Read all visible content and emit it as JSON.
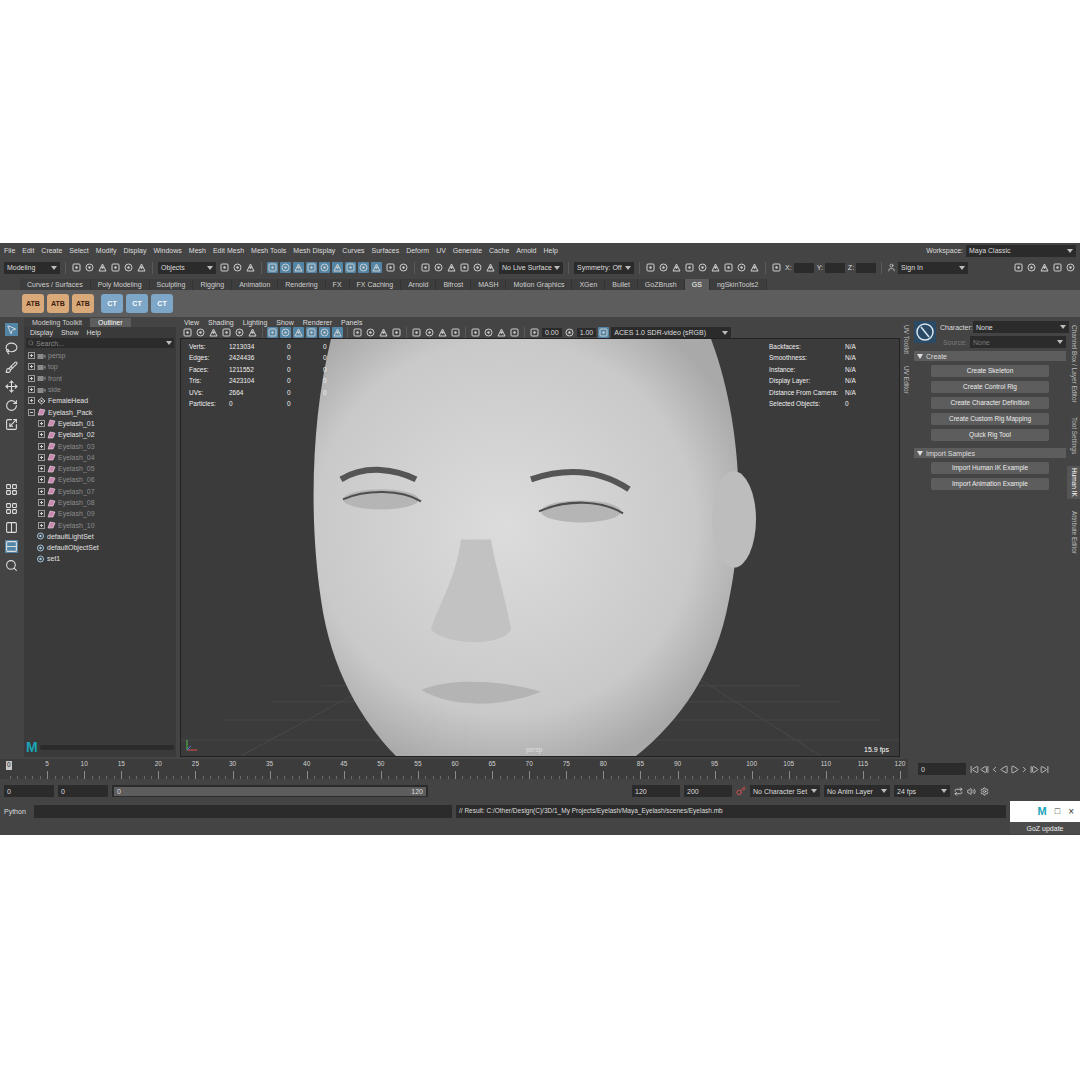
{
  "menu_bar": {
    "items": [
      "File",
      "Edit",
      "Create",
      "Select",
      "Modify",
      "Display",
      "Windows",
      "Mesh",
      "Edit Mesh",
      "Mesh Tools",
      "Mesh Display",
      "Curves",
      "Surfaces",
      "Deform",
      "UV",
      "Generate",
      "Cache",
      "Arnold",
      "Help"
    ],
    "workspace_label": "Workspace:",
    "workspace": "Maya Classic"
  },
  "status_line": {
    "menu_set": "Modeling",
    "select_mode": "Objects",
    "live_surface": "No Live Surface",
    "symmetry": "Symmetry: Off",
    "coords": [
      "X:",
      "Y:",
      "Z:"
    ],
    "sign_in": "Sign In"
  },
  "shelf": {
    "tabs": [
      {
        "label": "Curves / Surfaces",
        "selected": false
      },
      {
        "label": "Poly Modeling",
        "selected": false
      },
      {
        "label": "Sculpting",
        "selected": false
      },
      {
        "label": "Rigging",
        "selected": false
      },
      {
        "label": "Animation",
        "selected": false
      },
      {
        "label": "Rendering",
        "selected": false
      },
      {
        "label": "FX",
        "selected": false
      },
      {
        "label": "FX Caching",
        "selected": false
      },
      {
        "label": "Arnold",
        "selected": false
      },
      {
        "label": "Bifrost",
        "selected": false
      },
      {
        "label": "MASH",
        "selected": false
      },
      {
        "label": "Motion Graphics",
        "selected": false
      },
      {
        "label": "XGen",
        "selected": false
      },
      {
        "label": "Bullet",
        "selected": false
      },
      {
        "label": "GoZBrush",
        "selected": false
      },
      {
        "label": "GS",
        "selected": true
      },
      {
        "label": "ngSkinTools2",
        "selected": false
      }
    ],
    "buttons": [
      "ATB",
      "ATB",
      "ATB",
      "CT",
      "CT",
      "CT"
    ]
  },
  "outliner": {
    "tabs": [
      {
        "label": "Modeling Toolkit",
        "selected": false
      },
      {
        "label": "Outliner",
        "selected": true
      }
    ],
    "menu": [
      "Display",
      "Show",
      "Help"
    ],
    "search_placeholder": "Search...",
    "items": [
      {
        "name": "persp",
        "kind": "camera",
        "depth": 0,
        "dimmed": true,
        "expandable": true,
        "expanded": false
      },
      {
        "name": "top",
        "kind": "camera",
        "depth": 0,
        "dimmed": true,
        "expandable": true,
        "expanded": false
      },
      {
        "name": "front",
        "kind": "camera",
        "depth": 0,
        "dimmed": true,
        "expandable": true,
        "expanded": false
      },
      {
        "name": "side",
        "kind": "camera",
        "depth": 0,
        "dimmed": true,
        "expandable": true,
        "expanded": false
      },
      {
        "name": "FemaleHead",
        "kind": "group",
        "depth": 0,
        "dimmed": false,
        "expandable": true,
        "expanded": false
      },
      {
        "name": "Eyelash_Pack",
        "kind": "mesh",
        "depth": 0,
        "dimmed": false,
        "expandable": true,
        "expanded": true
      },
      {
        "name": "Eyelash_01",
        "kind": "mesh",
        "depth": 1,
        "dimmed": false,
        "expandable": true,
        "expanded": false
      },
      {
        "name": "Eyelash_02",
        "kind": "mesh",
        "depth": 1,
        "dimmed": false,
        "expandable": true,
        "expanded": false
      },
      {
        "name": "Eyelash_03",
        "kind": "mesh",
        "depth": 1,
        "dimmed": true,
        "expandable": true,
        "expanded": false
      },
      {
        "name": "Eyelash_04",
        "kind": "mesh",
        "depth": 1,
        "dimmed": true,
        "expandable": true,
        "expanded": false
      },
      {
        "name": "Eyelash_05",
        "kind": "mesh",
        "depth": 1,
        "dimmed": true,
        "expandable": true,
        "expanded": false
      },
      {
        "name": "Eyelash_06",
        "kind": "mesh",
        "depth": 1,
        "dimmed": true,
        "expandable": true,
        "expanded": false
      },
      {
        "name": "Eyelash_07",
        "kind": "mesh",
        "depth": 1,
        "dimmed": true,
        "expandable": true,
        "expanded": false
      },
      {
        "name": "Eyelash_08",
        "kind": "mesh",
        "depth": 1,
        "dimmed": true,
        "expandable": true,
        "expanded": false
      },
      {
        "name": "Eyelash_09",
        "kind": "mesh",
        "depth": 1,
        "dimmed": true,
        "expandable": true,
        "expanded": false
      },
      {
        "name": "Eyelash_10",
        "kind": "mesh",
        "depth": 1,
        "dimmed": true,
        "expandable": true,
        "expanded": false
      },
      {
        "name": "defaultLightSet",
        "kind": "set",
        "depth": 0,
        "dimmed": false,
        "expandable": false,
        "expanded": false
      },
      {
        "name": "defaultObjectSet",
        "kind": "set",
        "depth": 0,
        "dimmed": false,
        "expandable": false,
        "expanded": false
      },
      {
        "name": "set1",
        "kind": "set",
        "depth": 0,
        "dimmed": false,
        "expandable": false,
        "expanded": false
      }
    ],
    "logo": "M"
  },
  "viewport": {
    "menu": [
      "View",
      "Shading",
      "Lighting",
      "Show",
      "Renderer",
      "Panels"
    ],
    "exposure": "0.00",
    "gamma": "1.00",
    "color_space": "ACES 1.0 SDR-video (sRGB)",
    "hud_left": [
      {
        "label": "Verts:",
        "values": [
          "1213034",
          "0",
          "0"
        ]
      },
      {
        "label": "Edges:",
        "values": [
          "2424436",
          "0",
          "0"
        ]
      },
      {
        "label": "Faces:",
        "values": [
          "1211552",
          "0",
          "0"
        ]
      },
      {
        "label": "Tris:",
        "values": [
          "2423104",
          "0",
          "0"
        ]
      },
      {
        "label": "UVs:",
        "values": [
          "2664",
          "0",
          "0"
        ]
      },
      {
        "label": "Particles:",
        "values": [
          "0",
          "0"
        ]
      }
    ],
    "hud_right": [
      {
        "label": "Backfaces:",
        "value": "N/A"
      },
      {
        "label": "Smoothness:",
        "value": "N/A"
      },
      {
        "label": "Instance:",
        "value": "N/A"
      },
      {
        "label": "Display Layer:",
        "value": "N/A"
      },
      {
        "label": "Distance From Camera:",
        "value": "N/A"
      },
      {
        "label": "Selected Objects:",
        "value": "0"
      }
    ],
    "camera": "persp",
    "fps": "15.9 fps"
  },
  "side_tabs_left": [
    "UV Toolkit",
    "UV Editor"
  ],
  "human_ik": {
    "character_label": "Character:",
    "character": "None",
    "source_label": "Source:",
    "source": "None",
    "source_disabled": true,
    "sections": [
      {
        "title": "Create",
        "expanded": true,
        "buttons": [
          "Create Skeleton",
          "Create Control Rig",
          "Create Character Definition",
          "Create Custom Rig Mapping",
          "Quick Rig Tool"
        ]
      },
      {
        "title": "Import Samples",
        "expanded": true,
        "buttons": [
          "Import Human IK Example",
          "Import Animation Example"
        ]
      }
    ]
  },
  "side_tabs_right": [
    {
      "label": "Channel Box / Layer Editor",
      "selected": false
    },
    {
      "label": "Tool Settings",
      "selected": false
    },
    {
      "label": "Human IK",
      "selected": true
    },
    {
      "label": "Attribute Editor",
      "selected": false
    }
  ],
  "time_slider": {
    "ticks": [
      "5",
      "10",
      "15",
      "20",
      "25",
      "30",
      "35",
      "40",
      "45",
      "50",
      "55",
      "60",
      "65",
      "70",
      "75",
      "80",
      "85",
      "90",
      "95",
      "100",
      "105",
      "110",
      "115",
      "120"
    ],
    "current_frame": "0",
    "frame_field": "0"
  },
  "range_slider": {
    "start": "0",
    "range_start": "0",
    "inner_start": "0",
    "inner_end": "120",
    "range_end": "120",
    "end": "200",
    "character_set": "No Character Set",
    "anim_layer": "No Anim Layer",
    "fps": "24 fps"
  },
  "command_line": {
    "language": "Python",
    "result": "// Result: C:/Other/Design(C)/3D/1_My Projects/Eyelash/Maya_Eyelash/scenes/Eyelash.mb"
  },
  "popup": {
    "logo": "M",
    "maximize": "□",
    "close": "×"
  },
  "goz_button": "GoZ update"
}
